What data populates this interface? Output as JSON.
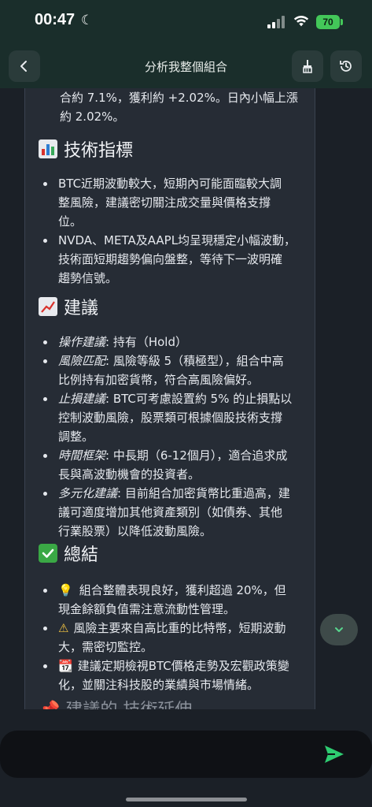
{
  "status_bar": {
    "time": "00:47",
    "battery": "70"
  },
  "header": {
    "title": "分析我整個組合"
  },
  "content": {
    "intro_lines": [
      "合約 7.1%，獲利約 +2.02%。日內小幅上漲",
      "約 2.02%。"
    ],
    "tech_heading": "技術指標",
    "tech_items": [
      [
        "BTC近期波動較大，短期內可能面臨較大調",
        "整風險，建議密切關注成交量與價格支撐",
        "位。"
      ],
      [
        "NVDA、META及AAPL均呈現穩定小幅波動，",
        "技術面短期趨勢偏向盤整，等待下一波明確",
        "趨勢信號。"
      ]
    ],
    "advice_heading": "建議",
    "advice_items": [
      {
        "label": "操作建議",
        "lines": [
          ": 持有（Hold）"
        ]
      },
      {
        "label": "風險匹配",
        "lines": [
          ": 風險等級 5（積極型），組合中高",
          "比例持有加密貨幣，符合高風險偏好。"
        ]
      },
      {
        "label": "止損建議",
        "lines": [
          ": BTC可考慮設置約 5% 的止損點以",
          "控制波動風險，股票類可根據個股技術支撐",
          "調整。"
        ]
      },
      {
        "label": "時間框架",
        "lines": [
          ": 中長期（6-12個月），適合追求成",
          "長與高波動機會的投資者。"
        ]
      },
      {
        "label": "多元化建議",
        "lines": [
          ": 目前組合加密貨幣比重過高，建",
          "議可適度增加其他資產類別（如債券、其他",
          "行業股票）以降低波動風險。"
        ]
      }
    ],
    "summary_heading": "總結",
    "summary_items": [
      {
        "icon": "💡",
        "lines": [
          "組合整體表現良好，獲利超過 20%，但",
          "現金餘額負值需注意流動性管理。"
        ]
      },
      {
        "icon": "⚠",
        "lines": [
          "風險主要來自高比重的比特幣，短期波動",
          "大，需密切監控。"
        ]
      },
      {
        "icon": "📆",
        "lines": [
          "建議定期檢視BTC價格走勢及宏觀政策變",
          "化，並關注科技股的業績與市場情緒。"
        ]
      }
    ],
    "cut_off_heading": "📌 建議的 技術延伸"
  },
  "colors": {
    "header_bg": "#1a2e2b",
    "card_bg": "#262c35",
    "send_green": "#2ecc71"
  }
}
